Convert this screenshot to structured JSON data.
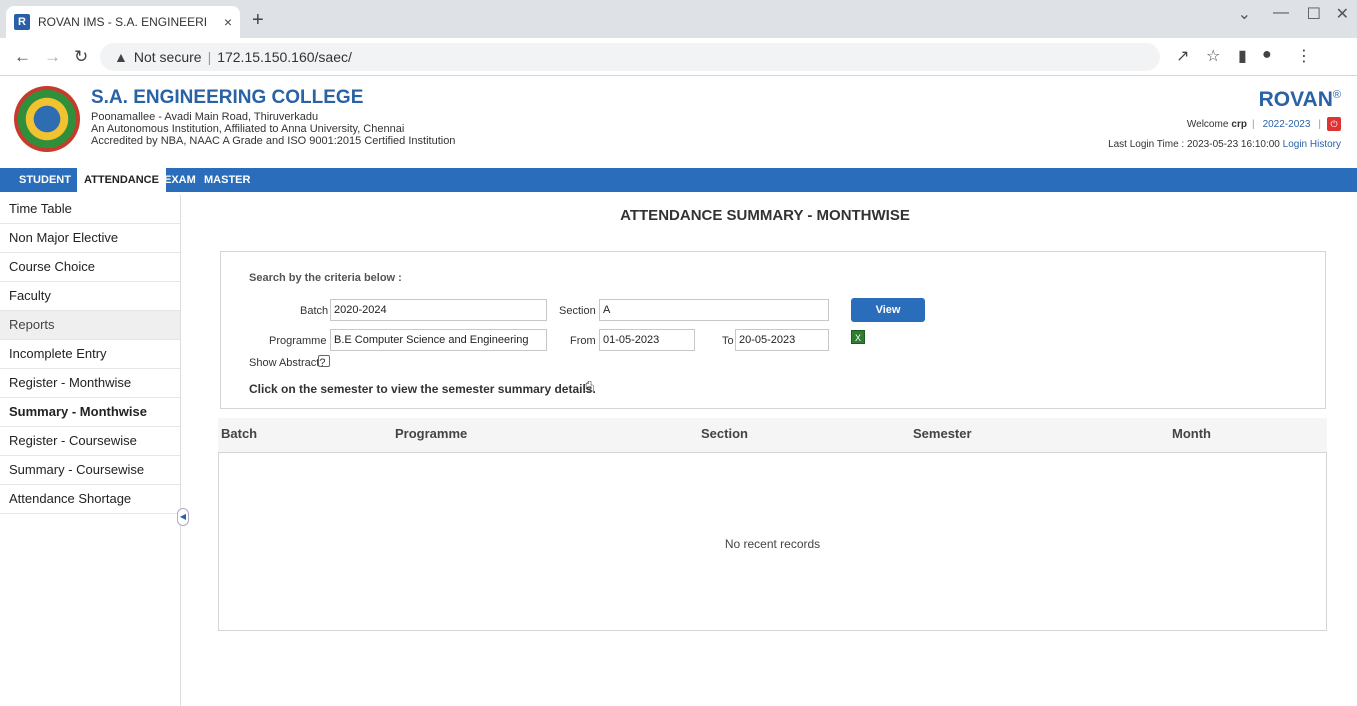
{
  "browser": {
    "tab_favicon": "R",
    "tab_title": "ROVAN IMS - S.A. ENGINEERING",
    "tab_close": "×",
    "new_tab": "+",
    "security_label": "Not secure",
    "url": "172.15.150.160/saec/"
  },
  "header": {
    "college_name": "S.A. ENGINEERING COLLEGE",
    "address_line1": "Poonamallee - Avadi Main Road, Thiruverkadu",
    "address_line2": "An Autonomous Institution, Affiliated to Anna University, Chennai",
    "address_line3": "Accredited by NBA, NAAC A Grade and ISO 9001:2015 Certified Institution",
    "brand": "ROVAN",
    "brand_mark": "®",
    "welcome_prefix": "Welcome",
    "username": "crp",
    "academic_year": "2022-2023",
    "last_login_label": "Last Login Time : 2023-05-23 16:10:00",
    "login_history_link": "Login History"
  },
  "nav": {
    "items": [
      {
        "label": "STUDENT"
      },
      {
        "label": "ATTENDANCE"
      },
      {
        "label": "EXAM"
      },
      {
        "label": "MASTER"
      }
    ]
  },
  "sidebar": {
    "items": [
      {
        "label": "Time Table"
      },
      {
        "label": "Non Major Elective"
      },
      {
        "label": "Course Choice"
      },
      {
        "label": "Faculty"
      },
      {
        "label": "Reports"
      },
      {
        "label": "Incomplete Entry"
      },
      {
        "label": "Register - Monthwise"
      },
      {
        "label": "Summary - Monthwise"
      },
      {
        "label": "Register - Coursewise"
      },
      {
        "label": "Summary - Coursewise"
      },
      {
        "label": "Attendance Shortage"
      }
    ]
  },
  "main": {
    "title": "ATTENDANCE SUMMARY - MONTHWISE",
    "criteria_heading": "Search by the criteria below :",
    "batch_label": "Batch",
    "batch_value": "2020-2024",
    "section_label": "Section",
    "section_value": "A",
    "programme_label": "Programme",
    "programme_value": "B.E Computer Science and Engineering",
    "from_label": "From",
    "from_value": "01-05-2023",
    "to_label": "To",
    "to_value": "20-05-2023",
    "view_button": "View",
    "show_abstract_label": "Show Abstract?",
    "hint": "Click on the semester to view the semester summary details.",
    "table": {
      "columns": [
        "Batch",
        "Programme",
        "Section",
        "Semester",
        "Month"
      ],
      "empty_message": "No recent records"
    }
  }
}
